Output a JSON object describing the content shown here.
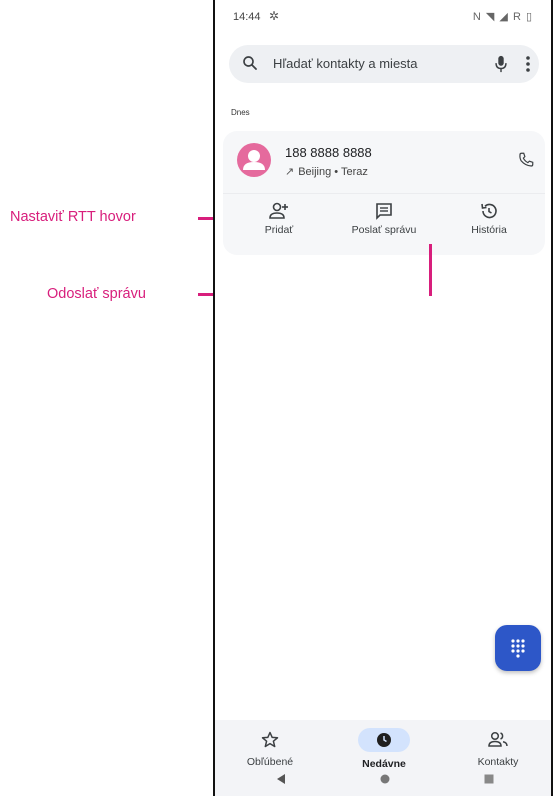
{
  "status": {
    "time": "14:44",
    "right": "N ◥ ◢ R ▯"
  },
  "search": {
    "placeholder": "Hľadať kontakty a miesta"
  },
  "recents": {
    "section_label": "Dnes",
    "items": [
      {
        "number": "188 8888 8888",
        "detail": "Beijing • Teraz"
      }
    ]
  },
  "actions": [
    {
      "label": "Pridať"
    },
    {
      "label": "Poslať správu"
    },
    {
      "label": "História"
    }
  ],
  "bottom_nav": [
    {
      "label": "Obľúbené"
    },
    {
      "label": "Nedávne"
    },
    {
      "label": "Kontakty"
    }
  ],
  "callouts": {
    "rtt": "Nastaviť RTT hovor",
    "message": "Odoslať správu"
  },
  "colors": {
    "accent": "#d81e7c",
    "avatar": "#e56a9d",
    "fab": "#2d57c8",
    "nav_active": "#d3e3fd"
  }
}
